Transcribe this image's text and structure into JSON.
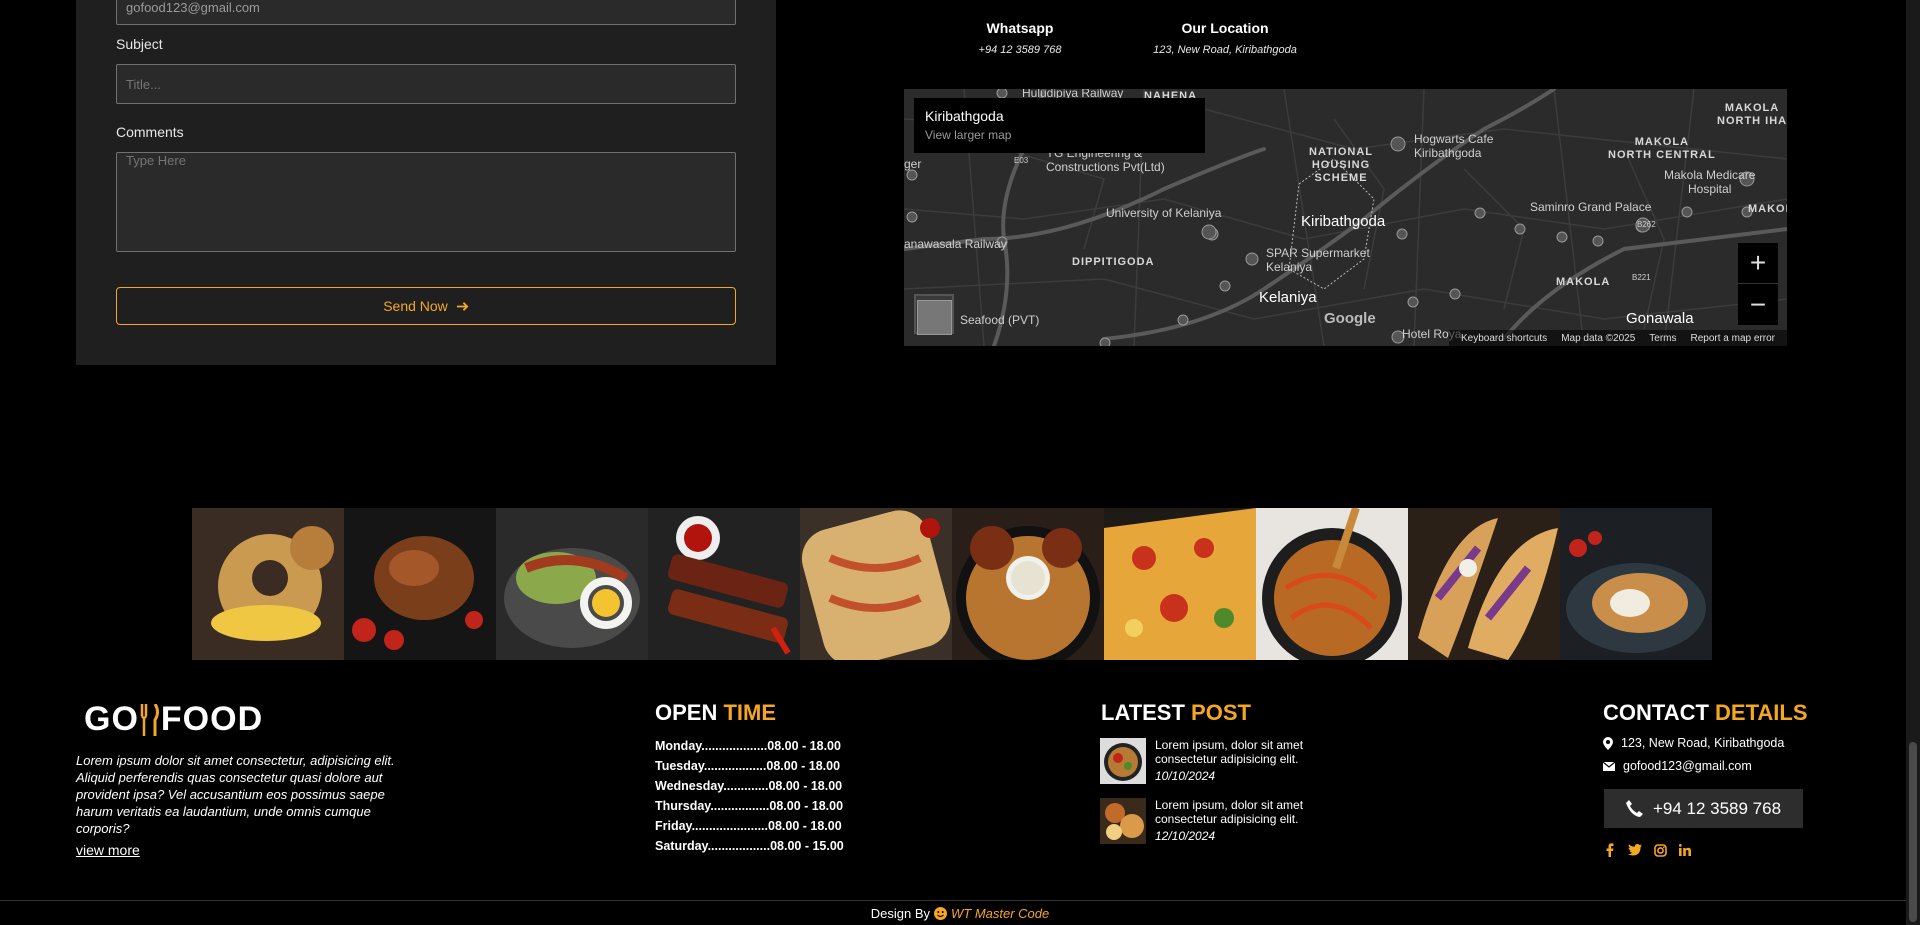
{
  "form": {
    "email_value": "gofood123@gmail.com",
    "subject_label": "Subject",
    "subject_placeholder": "Title...",
    "comments_label": "Comments",
    "comments_placeholder": "Type Here",
    "send_label": "Send Now"
  },
  "info": {
    "whatsapp_title": "Whatsapp",
    "whatsapp_value": "+94 12 3589 768",
    "location_title": "Our Location",
    "location_value": "123, New Road, Kiribathgoda"
  },
  "map": {
    "place": "Kiribathgoda",
    "larger_link": "View larger map",
    "zoom_in": "+",
    "zoom_out": "−",
    "google": "Google",
    "labels": {
      "huludipiya": "Huludipiya Railway",
      "nahena": "NAHENA",
      "engineering": "YG Engineering &\nConstructions Pvt(Ltd)",
      "university": "University of Kelaniya",
      "railway": "anawasala Railway",
      "dippitigoda": "DIPPITIGODA",
      "national": "NATIONAL\nHOUSING\nSCHEME",
      "hogwarts": "Hogwarts Cafe\nKiribathgoda",
      "kiribathgoda": "Kiribathgoda",
      "spar": "SPAR Supermarket\nKelaniya",
      "kelaniya": "Kelaniya",
      "seafood": "Seafood (PVT)",
      "makola_north": "MAKOLA\nNORTH IHA",
      "makola_central": "MAKOLA\nNORTH CENTRAL",
      "medicare": "Makola Medicare\nHospital",
      "saminro": "Saminro Grand Palace",
      "makola": "MAKOLA",
      "gonawala": "Gonawala",
      "hotel": "Hotel Roya",
      "ger": "ger",
      "makol": "MAKOL",
      "e03": "E03",
      "b262": "B262",
      "b221": "B221"
    },
    "footer": {
      "shortcuts": "Keyboard shortcuts",
      "data": "Map data ©2025",
      "terms": "Terms",
      "report": "Report a map error"
    }
  },
  "footer": {
    "logo_left": "GO",
    "logo_right": "FOOD",
    "about": "Lorem ipsum dolor sit amet consectetur, adipisicing elit. Aliquid perferendis quas consectetur quasi dolore aut provident ipsa? Vel accusantium eos possimus saepe harum veritatis ea laudantium, unde omnis cumque corporis?",
    "view_more": "view more",
    "open_time": {
      "word1": "OPEN",
      "word2": "TIME"
    },
    "hours": [
      "Monday...................08.00 - 18.00",
      "Tuesday..................08.00 - 18.00",
      "Wednesday.............08.00 - 18.00",
      "Thursday.................08.00 - 18.00",
      "Friday......................08.00 - 18.00",
      "Saturday..................08.00 - 15.00"
    ],
    "latest_post": {
      "word1": "LATEST",
      "word2": "POST"
    },
    "posts": [
      {
        "text": "Lorem ipsum, dolor sit amet consectetur adipisicing elit.",
        "date": "10/10/2024"
      },
      {
        "text": "Lorem ipsum, dolor sit amet consectetur adipisicing elit.",
        "date": "12/10/2024"
      }
    ],
    "contact_details": {
      "word1": "CONTACT",
      "word2": "DETAILS"
    },
    "address": "123, New Road, Kiribathgoda",
    "email": "gofood123@gmail.com",
    "phone": "+94 12 3589 768",
    "social_icons": [
      "facebook-icon",
      "twitter-icon",
      "instagram-icon",
      "linkedin-icon"
    ]
  },
  "bottom": {
    "design_by": "Design By",
    "brand": "WT Master Code"
  },
  "colors": {
    "accent": "#f5a623",
    "panel": "#1f1f1f",
    "background": "#000000"
  }
}
